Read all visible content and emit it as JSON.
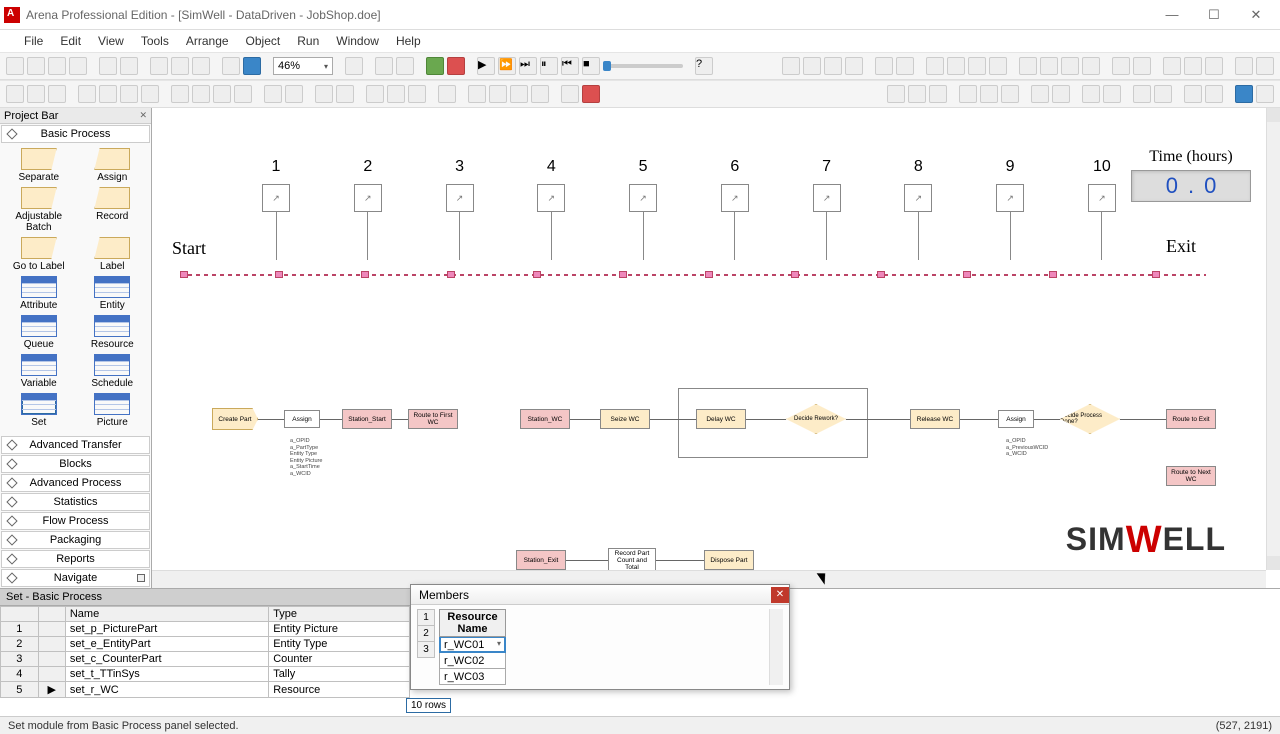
{
  "title": "Arena Professional Edition - [SimWell - DataDriven - JobShop.doe]",
  "menu": [
    "File",
    "Edit",
    "View",
    "Tools",
    "Arrange",
    "Object",
    "Run",
    "Window",
    "Help"
  ],
  "zoom": "46%",
  "projectbar": {
    "title": "Project Bar",
    "active_cat": "Basic Process",
    "modules": [
      {
        "label": "Separate",
        "shape": "trap-l"
      },
      {
        "label": "Assign",
        "shape": "trap-r"
      },
      {
        "label": "Adjustable\nBatch",
        "shape": "trap-l"
      },
      {
        "label": "Record",
        "shape": "trap-r"
      },
      {
        "label": "Go to Label",
        "shape": "trap-l"
      },
      {
        "label": "Label",
        "shape": "trap-r"
      },
      {
        "label": "Attribute",
        "shape": "table"
      },
      {
        "label": "Entity",
        "shape": "table"
      },
      {
        "label": "Queue",
        "shape": "table"
      },
      {
        "label": "Resource",
        "shape": "table"
      },
      {
        "label": "Variable",
        "shape": "table"
      },
      {
        "label": "Schedule",
        "shape": "table"
      },
      {
        "label": "Set",
        "shape": "table-sel"
      },
      {
        "label": "Picture",
        "shape": "table"
      }
    ],
    "cats": [
      "Advanced Transfer",
      "Blocks",
      "Advanced Process",
      "Statistics",
      "Flow Process",
      "Packaging",
      "Reports",
      "Navigate"
    ]
  },
  "stations": [
    "1",
    "2",
    "3",
    "4",
    "5",
    "6",
    "7",
    "8",
    "9",
    "10"
  ],
  "start_label": "Start",
  "exit_label": "Exit",
  "time": {
    "label": "Time (hours)",
    "value_l": "0",
    "value_r": "0"
  },
  "flow": {
    "create": "Create Part",
    "assign1": "Assign",
    "station_start": "Station_Start",
    "route_first": "Route to First WC",
    "station_wc": "Station_WC",
    "seize": "Seize WC",
    "delay": "Delay WC",
    "decide_rework": "Decide Rework?",
    "release": "Release WC",
    "assign2": "Assign",
    "decide_done": "Decide Process Done?",
    "route_exit": "Route to Exit",
    "route_next": "Route to Next WC",
    "station_exit": "Station_Exit",
    "record": "Record Part Count and Total",
    "dispose": "Dispose Part",
    "attrs1": "a_OPID\na_PartType\nEntity Type\nEntity Picture\na_StartTime\na_WCID",
    "attrs2": "a_OPID\na_PreviousWCID\na_WCID"
  },
  "logo": {
    "pre": "S",
    "i1": "I",
    "m": "M",
    "w": "W",
    "post": "ELL"
  },
  "datasheet": {
    "title": "Set - Basic Process",
    "cols": [
      "Name",
      "Type"
    ],
    "rows": [
      {
        "n": "1",
        "name": "set_p_PicturePart",
        "type": "Entity Picture"
      },
      {
        "n": "2",
        "name": "set_e_EntityPart",
        "type": "Entity Type"
      },
      {
        "n": "3",
        "name": "set_c_CounterPart",
        "type": "Counter"
      },
      {
        "n": "4",
        "name": "set_t_TTinSys",
        "type": "Tally"
      },
      {
        "n": "5",
        "name": "set_r_WC",
        "type": "Resource",
        "sel": true
      }
    ],
    "rows_badge": "10 rows"
  },
  "members": {
    "title": "Members",
    "col": "Resource Name",
    "rows": [
      {
        "n": "1",
        "v": "r_WC01",
        "sel": true
      },
      {
        "n": "2",
        "v": "r_WC02"
      },
      {
        "n": "3",
        "v": "r_WC03"
      }
    ]
  },
  "status": {
    "left": "Set module from Basic Process panel selected.",
    "right": "(527, 2191)"
  }
}
